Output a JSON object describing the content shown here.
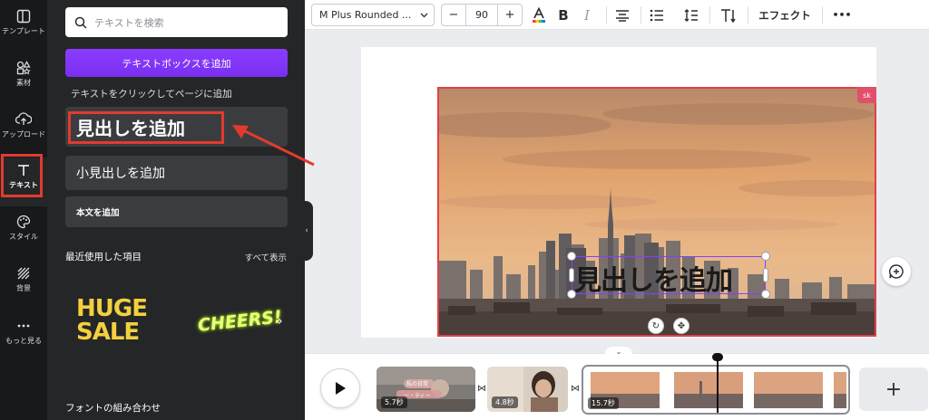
{
  "rail": {
    "items": [
      {
        "label": "テンプレート",
        "icon": "template-icon"
      },
      {
        "label": "素材",
        "icon": "elements-icon"
      },
      {
        "label": "アップロード",
        "icon": "upload-icon"
      },
      {
        "label": "テキスト",
        "icon": "text-icon",
        "active": true
      },
      {
        "label": "スタイル",
        "icon": "palette-icon"
      },
      {
        "label": "背景",
        "icon": "background-icon"
      },
      {
        "label": "もっと見る",
        "icon": "more-icon"
      }
    ]
  },
  "panel": {
    "search_placeholder": "テキストを検索",
    "add_textbox": "テキストボックスを追加",
    "click_hint": "テキストをクリックしてページに追加",
    "heading": "見出しを追加",
    "subheading": "小見出しを追加",
    "body": "本文を追加",
    "recent_title": "最近使用した項目",
    "see_all": "すべて表示",
    "recent_items": [
      "HUGE",
      "SALE",
      "CHEERS!"
    ],
    "font_combos": "フォントの組み合わせ"
  },
  "toolbar": {
    "font": "M Plus Rounded ...",
    "minus": "−",
    "size": "90",
    "plus": "+",
    "effects": "エフェクト",
    "more": "•••"
  },
  "canvas": {
    "collaborator": "sk",
    "text": "見出しを追加"
  },
  "timeline": {
    "clips": [
      {
        "duration": "5.7秒",
        "caption1": "私の日常",
        "caption2": "ー・ティー"
      },
      {
        "duration": "4.8秒"
      },
      {
        "duration": "15.7秒"
      }
    ],
    "add": "+"
  },
  "colors": {
    "accent": "#8b3dff",
    "highlight": "#e23b2e",
    "rail_bg": "#18191b",
    "panel_bg": "#252627"
  }
}
